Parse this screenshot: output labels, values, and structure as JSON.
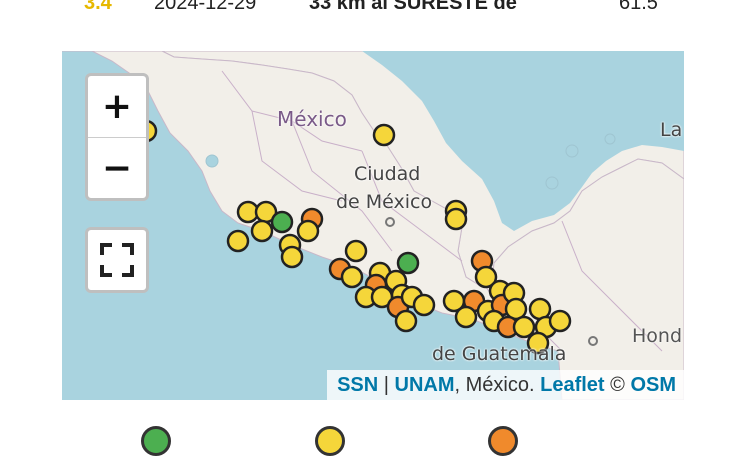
{
  "table_row": {
    "magnitude": "3.4",
    "date": "2024-12-29",
    "location": "33 km al SURESTE de",
    "depth": "61.5"
  },
  "map": {
    "labels": {
      "country": "México",
      "capital_line1": "Ciudad",
      "capital_line2": "de México",
      "guatemala": "de Guatemala",
      "la": "La",
      "honduras": "Hond"
    },
    "controls": {
      "zoom_in": "+",
      "zoom_out": "−"
    },
    "attribution": {
      "ssn": "SSN",
      "sep1": " | ",
      "unam": "UNAM",
      "country": ", México.",
      "leaflet": "Leaflet",
      "copy": " © ",
      "osm": "OSM"
    },
    "colors": {
      "water": "#a9d3df",
      "land": "#f2efe9",
      "green": "#4caf50",
      "yellow": "#f5d63a",
      "orange": "#f08a2c"
    }
  },
  "legend": {
    "colors": [
      "#4caf50",
      "#f5d63a",
      "#f08a2c"
    ]
  }
}
